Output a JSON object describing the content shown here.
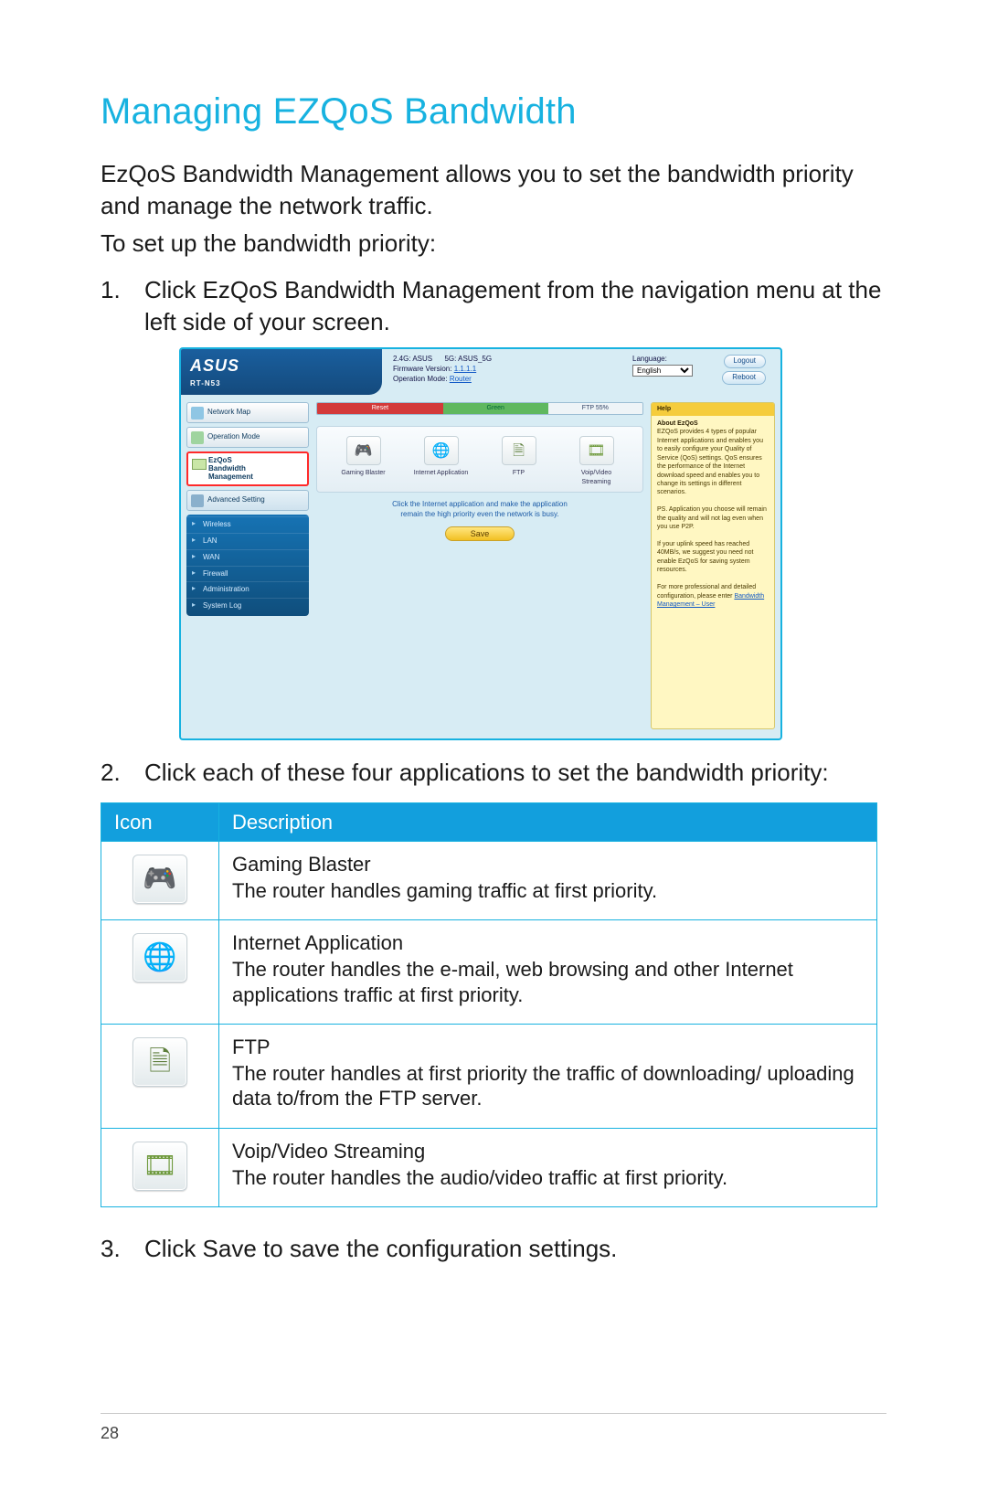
{
  "page": {
    "title": "Managing EZQoS Bandwidth",
    "intro1": "EzQoS Bandwidth Management allows you to set the bandwidth priority and manage the network traffic.",
    "intro2": "To set up the bandwidth priority:",
    "step1": "Click EzQoS Bandwidth Management from the navigation menu at the left side of your screen.",
    "step2": "Click each of these four applications to set the bandwidth priority:",
    "step3": "Click Save to save the configuration settings.",
    "page_number": "28"
  },
  "shot": {
    "brand": "ASUS",
    "model": "RT-N53",
    "ssid24_label": "2.4G: ASUS",
    "ssid5_label": "5G: ASUS_5G",
    "fw_label": "Firmware Version:",
    "fw_value": "1.1.1.1",
    "opmode_label": "Operation Mode:",
    "opmode_value": "Router",
    "language_label": "Language:",
    "language_value": "English",
    "logout": "Logout",
    "reboot": "Reboot",
    "side": {
      "map": "Network Map",
      "opmode": "Operation Mode",
      "ezqos_l1": "EzQoS",
      "ezqos_l2": "Bandwidth",
      "ezqos_l3": "Management",
      "adv": "Advanced Setting",
      "sub": [
        "Wireless",
        "LAN",
        "WAN",
        "Firewall",
        "Administration",
        "System Log"
      ]
    },
    "bar": {
      "seg1": "Reset",
      "seg2": "Green",
      "seg3": "FTP 55%"
    },
    "tiles": {
      "g": "Gaming Blaster",
      "i": "Internet Application",
      "f": "FTP",
      "v": "Voip/Video Streaming"
    },
    "hint1": "Click the Internet application and make the application",
    "hint2": "remain the high priority even the network is busy.",
    "save": "Save",
    "help": {
      "title": "Help",
      "about": "About EzQoS",
      "p1": "EZQoS provides 4 types of popular Internet applications and enables you to easily configure your Quality of Service (QoS) settings. QoS ensures the performance of the Internet download speed and enables you to change its settings in different scenarios.",
      "p2": "PS. Application you choose will remain the quality and will not lag even when you use P2P.",
      "p3": "If your uplink speed has reached 40MB/s, we suggest you need not enable EzQoS for saving system resources.",
      "p4a": "For more professional and detailed configuration, please enter",
      "p4b": "Bandwidth Management – User"
    }
  },
  "table": {
    "h1": "Icon",
    "h2": "Description",
    "rows": [
      {
        "title": "Gaming Blaster",
        "body": "The router handles gaming traffic at first priority."
      },
      {
        "title": "Internet Application",
        "body": "The router handles the e-mail, web browsing and other Internet applications traffic at first priority."
      },
      {
        "title": "FTP",
        "body": "The router handles at first priority the traffic of downloading/ uploading data to/from the FTP server."
      },
      {
        "title": "Voip/Video Streaming",
        "body": "The router handles the audio/video traffic at first priority."
      }
    ]
  }
}
